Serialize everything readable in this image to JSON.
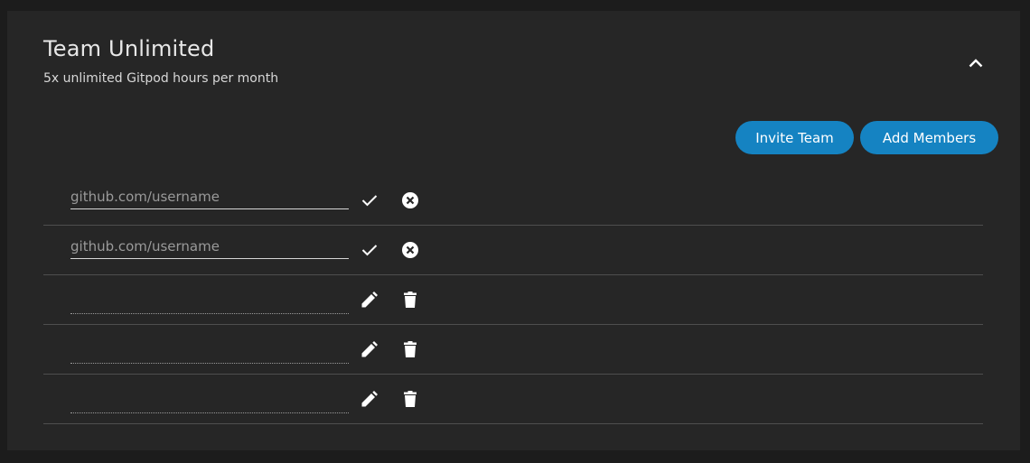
{
  "plan": {
    "title": "Team Unlimited",
    "subtitle": "5x unlimited Gitpod hours per month"
  },
  "actions": {
    "invite_team_label": "Invite Team",
    "add_members_label": "Add Members"
  },
  "members": [
    {
      "mode": "editing",
      "value": "",
      "placeholder": "github.com/username",
      "icons": [
        "check-icon",
        "cancel-circle-icon"
      ]
    },
    {
      "mode": "editing",
      "value": "",
      "placeholder": "github.com/username",
      "icons": [
        "check-icon",
        "cancel-circle-icon"
      ]
    },
    {
      "mode": "readonly",
      "value": "",
      "placeholder": "",
      "icons": [
        "pencil-icon",
        "trash-icon"
      ]
    },
    {
      "mode": "readonly",
      "value": "",
      "placeholder": "",
      "icons": [
        "pencil-icon",
        "trash-icon"
      ]
    },
    {
      "mode": "readonly",
      "value": "",
      "placeholder": "",
      "icons": [
        "pencil-icon",
        "trash-icon"
      ]
    }
  ],
  "icons": {
    "collapse": "chevron-up-icon"
  },
  "colors": {
    "page_background": "#1c1c1c",
    "card_background": "#262626",
    "button_accent": "#1583c2",
    "divider": "#4e4e4e"
  }
}
